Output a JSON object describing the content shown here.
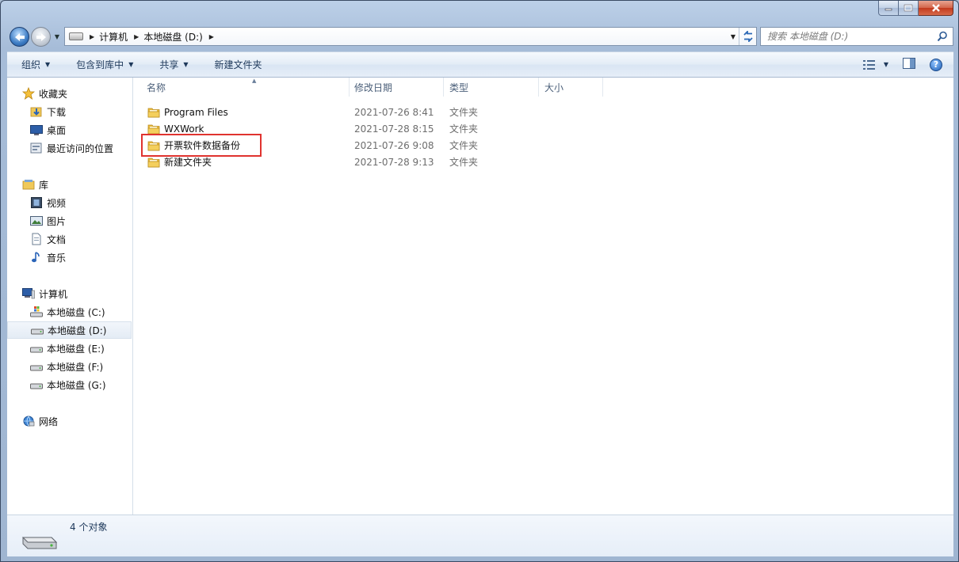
{
  "window": {
    "caption": {
      "minimize_icon": "minimize-icon",
      "maximize_icon": "maximize-icon",
      "close_icon": "close-icon"
    }
  },
  "address_bar": {
    "crumbs": [
      "计算机",
      "本地磁盘 (D:)"
    ],
    "search_placeholder": "搜索 本地磁盘 (D:)"
  },
  "toolbar": {
    "organize": "组织",
    "include_in_library": "包含到库中",
    "share": "共享",
    "new_folder": "新建文件夹"
  },
  "sidebar": {
    "favorites": {
      "label": "收藏夹",
      "items": [
        "下载",
        "桌面",
        "最近访问的位置"
      ]
    },
    "libraries": {
      "label": "库",
      "items": [
        "视频",
        "图片",
        "文档",
        "音乐"
      ]
    },
    "computer": {
      "label": "计算机",
      "items": [
        "本地磁盘 (C:)",
        "本地磁盘 (D:)",
        "本地磁盘 (E:)",
        "本地磁盘 (F:)",
        "本地磁盘 (G:)"
      ],
      "selected_index": 1
    },
    "network": {
      "label": "网络"
    }
  },
  "columns": {
    "name": "名称",
    "date": "修改日期",
    "type": "类型",
    "size": "大小"
  },
  "files": [
    {
      "name": "Program Files",
      "date": "2021-07-26 8:41",
      "type": "文件夹"
    },
    {
      "name": "WXWork",
      "date": "2021-07-28 8:15",
      "type": "文件夹"
    },
    {
      "name": "开票软件数据备份",
      "date": "2021-07-26 9:08",
      "type": "文件夹"
    },
    {
      "name": "新建文件夹",
      "date": "2021-07-28 9:13",
      "type": "文件夹"
    }
  ],
  "status": {
    "count": "4 个对象"
  },
  "colors": {
    "accent": "#1e395b",
    "highlight": "#e0332f",
    "selected_bg": "#e4ecf5"
  }
}
